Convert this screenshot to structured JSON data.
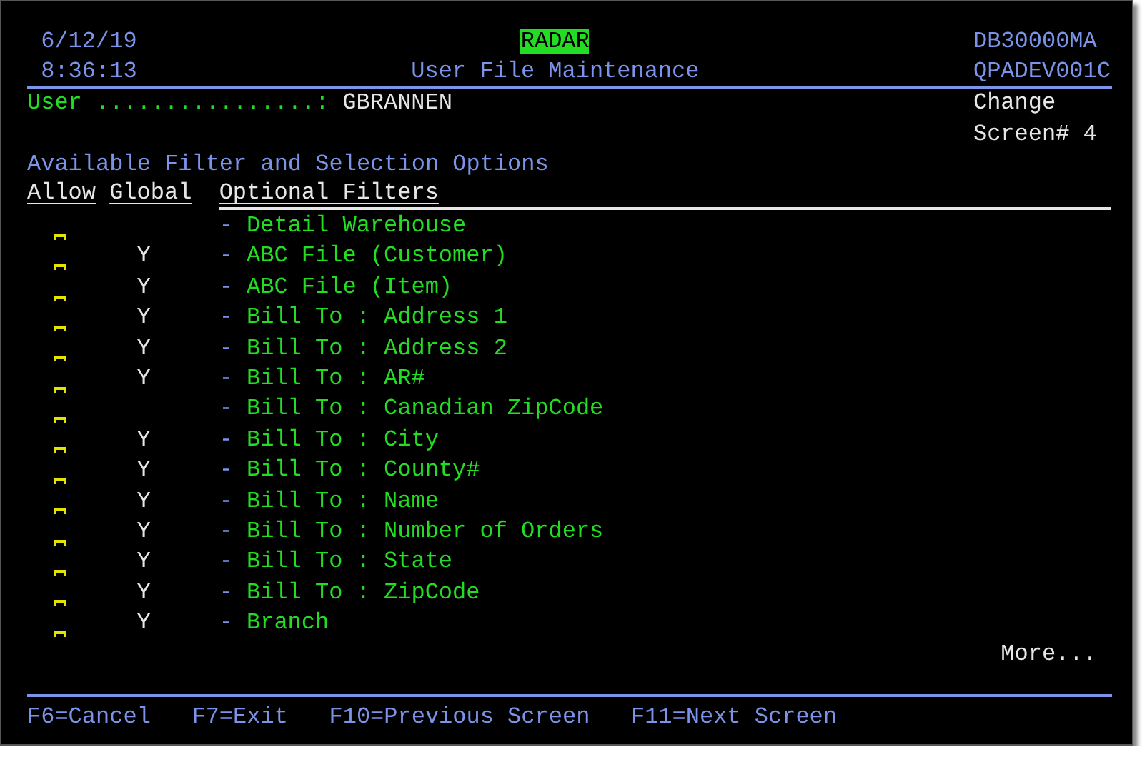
{
  "header": {
    "date": "6/12/19",
    "time": "8:36:13",
    "app": "RADAR",
    "title": "User File Maintenance",
    "program": "DB30000MA",
    "device": "QPADEV001C"
  },
  "user": {
    "label": "User ................:",
    "value": "GBRANNEN"
  },
  "mode": "Change",
  "screen": "Screen# 4",
  "section_title": "Available Filter and Selection Options",
  "columns": [
    "Allow",
    "Global",
    "Optional Filters"
  ],
  "rows": [
    {
      "marker": "-",
      "filter": "Detail Warehouse"
    },
    {
      "global": "Y",
      "marker": "-",
      "filter": "ABC File (Customer)"
    },
    {
      "global": "Y",
      "marker": "-",
      "filter": "ABC File (Item)"
    },
    {
      "global": "Y",
      "marker": "-",
      "filter": "Bill To : Address 1"
    },
    {
      "global": "Y",
      "marker": "-",
      "filter": "Bill To : Address 2"
    },
    {
      "global": "Y",
      "marker": "-",
      "filter": "Bill To : AR#"
    },
    {
      "marker": "-",
      "filter": "Bill To : Canadian ZipCode"
    },
    {
      "global": "Y",
      "marker": "-",
      "filter": "Bill To : City"
    },
    {
      "global": "Y",
      "marker": "-",
      "filter": "Bill To : County#"
    },
    {
      "global": "Y",
      "marker": "-",
      "filter": "Bill To : Name"
    },
    {
      "global": "Y",
      "marker": "-",
      "filter": "Bill To : Number of Orders"
    },
    {
      "global": "Y",
      "marker": "-",
      "filter": "Bill To : State"
    },
    {
      "global": "Y",
      "marker": "-",
      "filter": "Bill To : ZipCode"
    },
    {
      "global": "Y",
      "marker": "-",
      "filter": "Branch"
    }
  ],
  "more": "More...",
  "function_keys": [
    "F6=Cancel",
    "F7=Exit",
    "F10=Previous Screen",
    "F11=Next Screen"
  ]
}
